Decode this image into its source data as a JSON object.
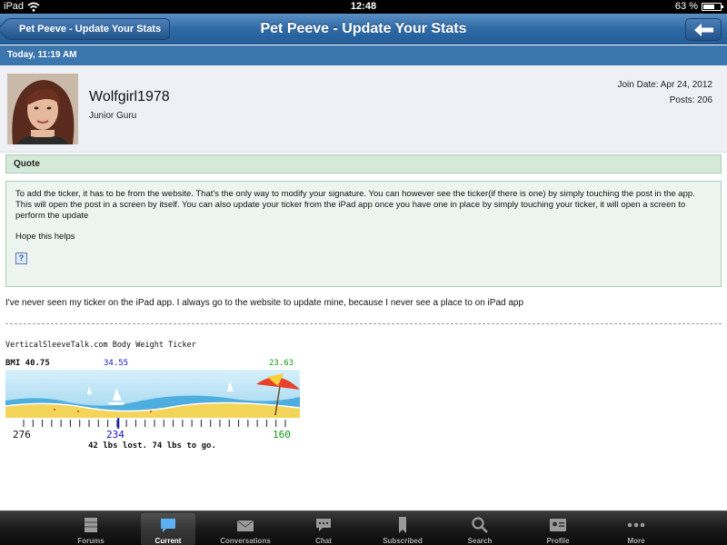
{
  "status_bar": {
    "carrier": "iPad",
    "time": "12:48",
    "battery": "63 %"
  },
  "nav": {
    "back_label": "Pet Peeve - Update Your Stats",
    "title": "Pet Peeve - Update Your Stats"
  },
  "date_bar": "Today, 11:19 AM",
  "post": {
    "username": "Wolfgirl1978",
    "user_title": "Junior Guru",
    "join_date": "Join Date: Apr 24, 2012",
    "posts": "Posts: 206"
  },
  "quote": {
    "header": "Quote",
    "paragraph1": "To add the ticker, it has to be from the website. That's the only way to modify your signature. You can however see the ticker(if there is one) by simply touching the post in the app. This will open the post in a screen by itself. You can also update your ticker from the iPad app once you have one in place by simply touching your ticker, it will open a screen to perform the update",
    "paragraph2": "Hope this helps",
    "icon_label": "?"
  },
  "reply_text": "I've never seen my ticker on the iPad app. I always go to the website to update mine, because I never see a place to on iPad app",
  "ticker": {
    "title": "VerticalSleeveTalk.com Body Weight Ticker",
    "bmi": "BMI 40.75",
    "current_bmi": "34.55",
    "goal_bmi": "23.63",
    "start_weight": "276",
    "current_weight": "234",
    "goal_weight": "160",
    "summary": "42 lbs lost. 74 lbs to go.",
    "progress_fraction": 0.362
  },
  "tabs": [
    {
      "label": "Forums",
      "icon": "forums-icon"
    },
    {
      "label": "Current",
      "icon": "current-icon"
    },
    {
      "label": "Conversations",
      "icon": "conversations-icon"
    },
    {
      "label": "Chat",
      "icon": "chat-icon"
    },
    {
      "label": "Subscribed",
      "icon": "subscribed-icon"
    },
    {
      "label": "Search",
      "icon": "search-icon"
    },
    {
      "label": "Profile",
      "icon": "profile-icon"
    },
    {
      "label": "More",
      "icon": "more-icon"
    }
  ],
  "active_tab": "Current",
  "colors": {
    "nav_blue": "#2f6aa6",
    "date_bar": "#3c76ae",
    "quote_green": "#d4e9d9",
    "current_blue": "#1414c8",
    "goal_green": "#119911"
  }
}
